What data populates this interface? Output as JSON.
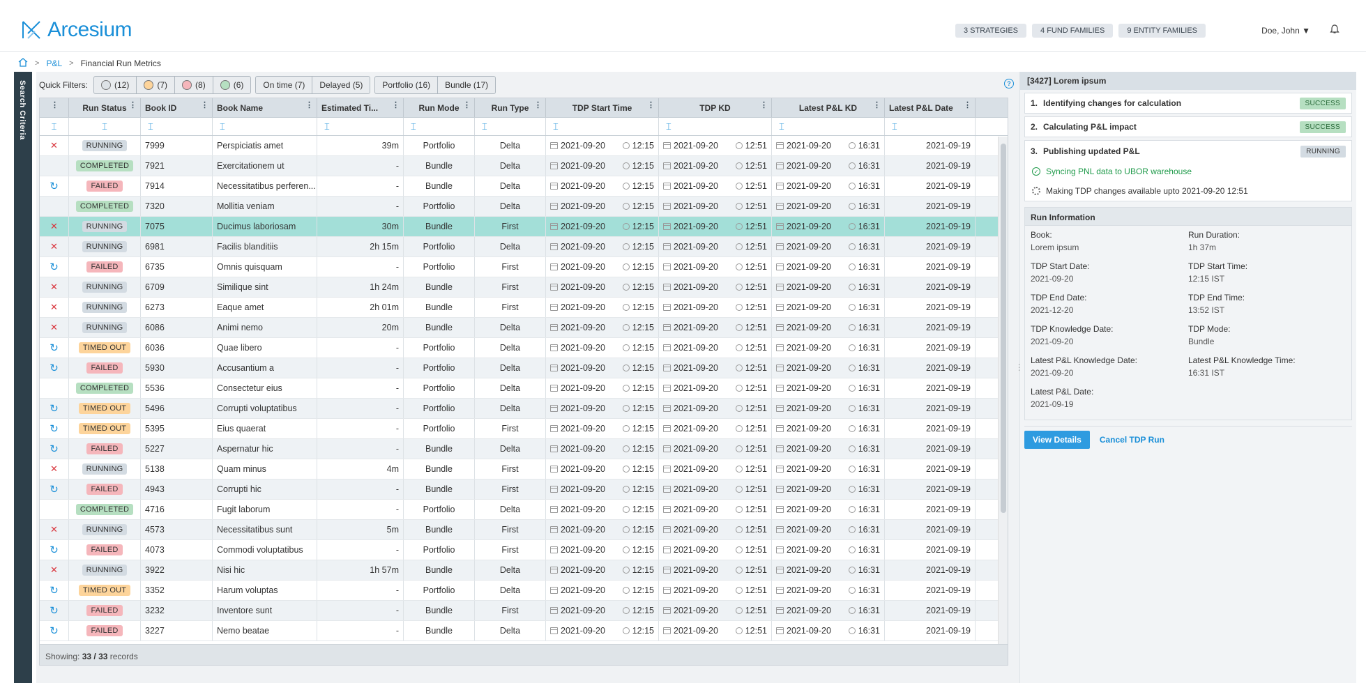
{
  "app": {
    "brand": "Arcesium"
  },
  "header": {
    "badges": [
      "3 STRATEGIES",
      "4 FUND FAMILIES",
      "9 ENTITY FAMILIES"
    ],
    "user": "Doe, John ▼"
  },
  "breadcrumb": {
    "home_icon": "home-icon",
    "items": [
      "P&L",
      "Financial Run Metrics"
    ]
  },
  "sidebar": {
    "label": "Search Criteria"
  },
  "quick_filters": {
    "label": "Quick Filters:",
    "status_filters": [
      {
        "count": "(12)",
        "color": "#dde2e6"
      },
      {
        "count": "(7)",
        "color": "#fdd49b"
      },
      {
        "count": "(8)",
        "color": "#f5b6bb"
      },
      {
        "count": "(6)",
        "color": "#b6dfc1"
      }
    ],
    "timing_filters": [
      "On time (7)",
      "Delayed (5)"
    ],
    "mode_filters": [
      "Portfolio (16)",
      "Bundle (17)"
    ]
  },
  "table": {
    "columns": [
      "",
      "Run Status",
      "Book ID",
      "Book Name",
      "Estimated Ti...",
      "Run Mode",
      "Run Type",
      "TDP Start Time",
      "TDP KD",
      "Latest P&L KD",
      "Latest P&L Date"
    ],
    "rows": [
      {
        "action": "x",
        "status": "RUNNING",
        "id": "7999",
        "name": "Perspiciatis amet",
        "est": "39m",
        "est_red": false,
        "mode": "Portfolio",
        "type": "Delta",
        "tdp_start": "2021-09-20",
        "tdp_start_t": "12:15",
        "tdp_kd": "2021-09-20",
        "tdp_kd_t": "12:51",
        "pl_kd": "2021-09-20",
        "pl_kd_t": "16:31",
        "pl_date": "2021-09-19"
      },
      {
        "action": "",
        "status": "COMPLETED",
        "id": "7921",
        "name": "Exercitationem ut",
        "est": "-",
        "est_red": false,
        "mode": "Bundle",
        "type": "Delta",
        "tdp_start": "2021-09-20",
        "tdp_start_t": "12:15",
        "tdp_kd": "2021-09-20",
        "tdp_kd_t": "12:51",
        "pl_kd": "2021-09-20",
        "pl_kd_t": "16:31",
        "pl_date": "2021-09-19"
      },
      {
        "action": "r",
        "status": "FAILED",
        "id": "7914",
        "name": "Necessitatibus perferen...",
        "est": "-",
        "est_red": false,
        "mode": "Bundle",
        "type": "Delta",
        "tdp_start": "2021-09-20",
        "tdp_start_t": "12:15",
        "tdp_kd": "2021-09-20",
        "tdp_kd_t": "12:51",
        "pl_kd": "2021-09-20",
        "pl_kd_t": "16:31",
        "pl_date": "2021-09-19"
      },
      {
        "action": "",
        "status": "COMPLETED",
        "id": "7320",
        "name": "Mollitia veniam",
        "est": "-",
        "est_red": false,
        "mode": "Portfolio",
        "type": "Delta",
        "tdp_start": "2021-09-20",
        "tdp_start_t": "12:15",
        "tdp_kd": "2021-09-20",
        "tdp_kd_t": "12:51",
        "pl_kd": "2021-09-20",
        "pl_kd_t": "16:31",
        "pl_date": "2021-09-19"
      },
      {
        "action": "x",
        "status": "RUNNING",
        "id": "7075",
        "name": "Ducimus laboriosam",
        "est": "30m",
        "est_red": false,
        "mode": "Bundle",
        "type": "First",
        "tdp_start": "2021-09-20",
        "tdp_start_t": "12:15",
        "tdp_kd": "2021-09-20",
        "tdp_kd_t": "12:51",
        "pl_kd": "2021-09-20",
        "pl_kd_t": "16:31",
        "pl_date": "2021-09-19",
        "selected": true
      },
      {
        "action": "x",
        "status": "RUNNING",
        "id": "6981",
        "name": "Facilis blanditiis",
        "est": "2h 15m",
        "est_red": true,
        "mode": "Portfolio",
        "type": "Delta",
        "tdp_start": "2021-09-20",
        "tdp_start_t": "12:15",
        "tdp_kd": "2021-09-20",
        "tdp_kd_t": "12:51",
        "pl_kd": "2021-09-20",
        "pl_kd_t": "16:31",
        "pl_date": "2021-09-19"
      },
      {
        "action": "r",
        "status": "FAILED",
        "id": "6735",
        "name": "Omnis quisquam",
        "est": "-",
        "est_red": false,
        "mode": "Portfolio",
        "type": "First",
        "tdp_start": "2021-09-20",
        "tdp_start_t": "12:15",
        "tdp_kd": "2021-09-20",
        "tdp_kd_t": "12:51",
        "pl_kd": "2021-09-20",
        "pl_kd_t": "16:31",
        "pl_date": "2021-09-19"
      },
      {
        "action": "x",
        "status": "RUNNING",
        "id": "6709",
        "name": "Similique sint",
        "est": "1h 24m",
        "est_red": true,
        "mode": "Bundle",
        "type": "First",
        "tdp_start": "2021-09-20",
        "tdp_start_t": "12:15",
        "tdp_kd": "2021-09-20",
        "tdp_kd_t": "12:51",
        "pl_kd": "2021-09-20",
        "pl_kd_t": "16:31",
        "pl_date": "2021-09-19"
      },
      {
        "action": "x",
        "status": "RUNNING",
        "id": "6273",
        "name": "Eaque amet",
        "est": "2h 01m",
        "est_red": true,
        "mode": "Bundle",
        "type": "First",
        "tdp_start": "2021-09-20",
        "tdp_start_t": "12:15",
        "tdp_kd": "2021-09-20",
        "tdp_kd_t": "12:51",
        "pl_kd": "2021-09-20",
        "pl_kd_t": "16:31",
        "pl_date": "2021-09-19"
      },
      {
        "action": "x",
        "status": "RUNNING",
        "id": "6086",
        "name": "Animi nemo",
        "est": "20m",
        "est_red": false,
        "mode": "Bundle",
        "type": "Delta",
        "tdp_start": "2021-09-20",
        "tdp_start_t": "12:15",
        "tdp_kd": "2021-09-20",
        "tdp_kd_t": "12:51",
        "pl_kd": "2021-09-20",
        "pl_kd_t": "16:31",
        "pl_date": "2021-09-19"
      },
      {
        "action": "r",
        "status": "TIMED OUT",
        "id": "6036",
        "name": "Quae libero",
        "est": "-",
        "est_red": false,
        "mode": "Portfolio",
        "type": "Delta",
        "tdp_start": "2021-09-20",
        "tdp_start_t": "12:15",
        "tdp_kd": "2021-09-20",
        "tdp_kd_t": "12:51",
        "pl_kd": "2021-09-20",
        "pl_kd_t": "16:31",
        "pl_date": "2021-09-19"
      },
      {
        "action": "r",
        "status": "FAILED",
        "id": "5930",
        "name": "Accusantium a",
        "est": "-",
        "est_red": false,
        "mode": "Portfolio",
        "type": "Delta",
        "tdp_start": "2021-09-20",
        "tdp_start_t": "12:15",
        "tdp_kd": "2021-09-20",
        "tdp_kd_t": "12:51",
        "pl_kd": "2021-09-20",
        "pl_kd_t": "16:31",
        "pl_date": "2021-09-19"
      },
      {
        "action": "",
        "status": "COMPLETED",
        "id": "5536",
        "name": "Consectetur eius",
        "est": "-",
        "est_red": false,
        "mode": "Portfolio",
        "type": "Delta",
        "tdp_start": "2021-09-20",
        "tdp_start_t": "12:15",
        "tdp_kd": "2021-09-20",
        "tdp_kd_t": "12:51",
        "pl_kd": "2021-09-20",
        "pl_kd_t": "16:31",
        "pl_date": "2021-09-19"
      },
      {
        "action": "r",
        "status": "TIMED OUT",
        "id": "5496",
        "name": "Corrupti voluptatibus",
        "est": "-",
        "est_red": false,
        "mode": "Portfolio",
        "type": "Delta",
        "tdp_start": "2021-09-20",
        "tdp_start_t": "12:15",
        "tdp_kd": "2021-09-20",
        "tdp_kd_t": "12:51",
        "pl_kd": "2021-09-20",
        "pl_kd_t": "16:31",
        "pl_date": "2021-09-19"
      },
      {
        "action": "r",
        "status": "TIMED OUT",
        "id": "5395",
        "name": "Eius quaerat",
        "est": "-",
        "est_red": false,
        "mode": "Portfolio",
        "type": "First",
        "tdp_start": "2021-09-20",
        "tdp_start_t": "12:15",
        "tdp_kd": "2021-09-20",
        "tdp_kd_t": "12:51",
        "pl_kd": "2021-09-20",
        "pl_kd_t": "16:31",
        "pl_date": "2021-09-19"
      },
      {
        "action": "r",
        "status": "FAILED",
        "id": "5227",
        "name": "Aspernatur hic",
        "est": "-",
        "est_red": false,
        "mode": "Bundle",
        "type": "Delta",
        "tdp_start": "2021-09-20",
        "tdp_start_t": "12:15",
        "tdp_kd": "2021-09-20",
        "tdp_kd_t": "12:51",
        "pl_kd": "2021-09-20",
        "pl_kd_t": "16:31",
        "pl_date": "2021-09-19"
      },
      {
        "action": "x",
        "status": "RUNNING",
        "id": "5138",
        "name": "Quam minus",
        "est": "4m",
        "est_red": false,
        "mode": "Bundle",
        "type": "First",
        "tdp_start": "2021-09-20",
        "tdp_start_t": "12:15",
        "tdp_kd": "2021-09-20",
        "tdp_kd_t": "12:51",
        "pl_kd": "2021-09-20",
        "pl_kd_t": "16:31",
        "pl_date": "2021-09-19"
      },
      {
        "action": "r",
        "status": "FAILED",
        "id": "4943",
        "name": "Corrupti hic",
        "est": "-",
        "est_red": false,
        "mode": "Bundle",
        "type": "First",
        "tdp_start": "2021-09-20",
        "tdp_start_t": "12:15",
        "tdp_kd": "2021-09-20",
        "tdp_kd_t": "12:51",
        "pl_kd": "2021-09-20",
        "pl_kd_t": "16:31",
        "pl_date": "2021-09-19"
      },
      {
        "action": "",
        "status": "COMPLETED",
        "id": "4716",
        "name": "Fugit laborum",
        "est": "-",
        "est_red": false,
        "mode": "Portfolio",
        "type": "Delta",
        "tdp_start": "2021-09-20",
        "tdp_start_t": "12:15",
        "tdp_kd": "2021-09-20",
        "tdp_kd_t": "12:51",
        "pl_kd": "2021-09-20",
        "pl_kd_t": "16:31",
        "pl_date": "2021-09-19"
      },
      {
        "action": "x",
        "status": "RUNNING",
        "id": "4573",
        "name": "Necessitatibus sunt",
        "est": "5m",
        "est_red": false,
        "mode": "Bundle",
        "type": "First",
        "tdp_start": "2021-09-20",
        "tdp_start_t": "12:15",
        "tdp_kd": "2021-09-20",
        "tdp_kd_t": "12:51",
        "pl_kd": "2021-09-20",
        "pl_kd_t": "16:31",
        "pl_date": "2021-09-19"
      },
      {
        "action": "r",
        "status": "FAILED",
        "id": "4073",
        "name": "Commodi voluptatibus",
        "est": "-",
        "est_red": false,
        "mode": "Portfolio",
        "type": "First",
        "tdp_start": "2021-09-20",
        "tdp_start_t": "12:15",
        "tdp_kd": "2021-09-20",
        "tdp_kd_t": "12:51",
        "pl_kd": "2021-09-20",
        "pl_kd_t": "16:31",
        "pl_date": "2021-09-19"
      },
      {
        "action": "x",
        "status": "RUNNING",
        "id": "3922",
        "name": "Nisi hic",
        "est": "1h 57m",
        "est_red": true,
        "mode": "Bundle",
        "type": "Delta",
        "tdp_start": "2021-09-20",
        "tdp_start_t": "12:15",
        "tdp_kd": "2021-09-20",
        "tdp_kd_t": "12:51",
        "pl_kd": "2021-09-20",
        "pl_kd_t": "16:31",
        "pl_date": "2021-09-19"
      },
      {
        "action": "r",
        "status": "TIMED OUT",
        "id": "3352",
        "name": "Harum voluptas",
        "est": "-",
        "est_red": false,
        "mode": "Portfolio",
        "type": "Delta",
        "tdp_start": "2021-09-20",
        "tdp_start_t": "12:15",
        "tdp_kd": "2021-09-20",
        "tdp_kd_t": "12:51",
        "pl_kd": "2021-09-20",
        "pl_kd_t": "16:31",
        "pl_date": "2021-09-19"
      },
      {
        "action": "r",
        "status": "FAILED",
        "id": "3232",
        "name": "Inventore sunt",
        "est": "-",
        "est_red": false,
        "mode": "Bundle",
        "type": "First",
        "tdp_start": "2021-09-20",
        "tdp_start_t": "12:15",
        "tdp_kd": "2021-09-20",
        "tdp_kd_t": "12:51",
        "pl_kd": "2021-09-20",
        "pl_kd_t": "16:31",
        "pl_date": "2021-09-19"
      },
      {
        "action": "r",
        "status": "FAILED",
        "id": "3227",
        "name": "Nemo beatae",
        "est": "-",
        "est_red": false,
        "mode": "Bundle",
        "type": "Delta",
        "tdp_start": "2021-09-20",
        "tdp_start_t": "12:15",
        "tdp_kd": "2021-09-20",
        "tdp_kd_t": "12:51",
        "pl_kd": "2021-09-20",
        "pl_kd_t": "16:31",
        "pl_date": "2021-09-19"
      }
    ],
    "footer": {
      "label": "Showing:",
      "count": "33 / 33",
      "suffix": "records"
    }
  },
  "panel": {
    "title": "[3427] Lorem ipsum",
    "steps": [
      {
        "num": "1.",
        "label": "Identifying changes for calculation",
        "status": "SUCCESS"
      },
      {
        "num": "2.",
        "label": "Calculating P&L impact",
        "status": "SUCCESS"
      },
      {
        "num": "3.",
        "label": "Publishing updated P&L",
        "status": "RUNNING"
      }
    ],
    "substeps": [
      "Syncing PNL data to UBOR warehouse",
      "Making TDP changes available upto 2021-09-20 12:51"
    ],
    "info_title": "Run Information",
    "info": [
      {
        "k": "Book:",
        "v": "Lorem ipsum"
      },
      {
        "k": "Run Duration:",
        "v": "1h 37m"
      },
      {
        "k": "TDP Start Date:",
        "v": "2021-09-20"
      },
      {
        "k": "TDP Start Time:",
        "v": "12:15 IST"
      },
      {
        "k": "TDP End Date:",
        "v": "2021-12-20"
      },
      {
        "k": "TDP End Time:",
        "v": "13:52 IST"
      },
      {
        "k": "TDP Knowledge Date:",
        "v": "2021-09-20"
      },
      {
        "k": "TDP Mode:",
        "v": "Bundle"
      },
      {
        "k": "Latest P&L Knowledge Date:",
        "v": "2021-09-20"
      },
      {
        "k": "Latest P&L Knowledge Time:",
        "v": "16:31 IST"
      },
      {
        "k": "Latest P&L Date:",
        "v": "2021-09-19"
      }
    ],
    "view_details": "View Details",
    "cancel": "Cancel TDP Run"
  }
}
